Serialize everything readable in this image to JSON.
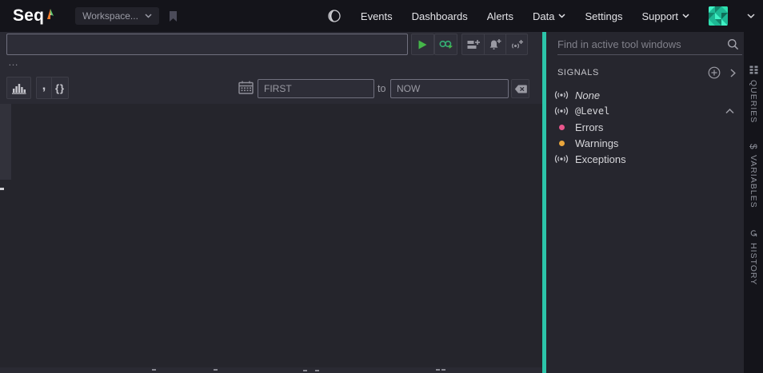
{
  "topbar": {
    "logo_text": "Seq",
    "workspace_button_label": "Workspace...",
    "nav_items": [
      "Events",
      "Dashboards",
      "Alerts",
      "Data",
      "Settings",
      "Support"
    ]
  },
  "querybar": {
    "search_value": "",
    "overflow_ellipsis": "…",
    "range_from_value": "FIRST",
    "range_separator": "to",
    "range_to_value": "NOW"
  },
  "tool_windows": {
    "find_placeholder": "Find in active tool windows",
    "signals_title": "SIGNALS",
    "signal_items": [
      {
        "label": "None"
      },
      {
        "label": "@Level"
      },
      {
        "label": "Errors"
      },
      {
        "label": "Warnings"
      },
      {
        "label": "Exceptions"
      }
    ]
  },
  "side_tabs": [
    "QUERIES",
    "VARIABLES",
    "HISTORY"
  ],
  "icons": {
    "quote_glyph": ",",
    "braces_glyph": "{}",
    "dollar_glyph": "$",
    "history_glyph": "↺"
  },
  "colors": {
    "accent_teal": "#2cc5a9",
    "play_green": "#45b649",
    "tail_green": "#35ad74",
    "errors_dot": "#e9568c",
    "warnings_dot": "#eaa63c"
  }
}
